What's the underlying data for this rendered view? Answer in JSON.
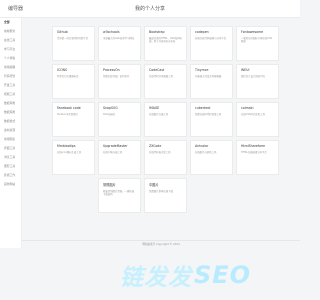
{
  "header": {
    "brand": "编导器",
    "title": "我的个人分享"
  },
  "sidebar": {
    "items": [
      {
        "label": "全部"
      },
      {
        "label": "前端框架"
      },
      {
        "label": "在线工具"
      },
      {
        "label": "学习平台"
      },
      {
        "label": "个人博客"
      },
      {
        "label": "常用编程"
      },
      {
        "label": "代码托管"
      },
      {
        "label": "开发工具"
      },
      {
        "label": "视频工具"
      },
      {
        "label": "数据库类"
      },
      {
        "label": "数据库类"
      },
      {
        "label": "数据格式"
      },
      {
        "label": "素材资源"
      },
      {
        "label": "常用图表"
      },
      {
        "label": "界面工具"
      },
      {
        "label": "浏览工具"
      },
      {
        "label": "图形工具"
      },
      {
        "label": "影视工作"
      },
      {
        "label": "其他网站"
      }
    ]
  },
  "cards": [
    {
      "name": "Github",
      "desc": "世界第一的开源代码托管平台"
    },
    {
      "name": "w3schools",
      "desc": "全球最大的web技术学习网站"
    },
    {
      "name": "Bootstrap",
      "desc": "最受欢迎的HTML、CSS和JS框架，用于开发响应式布局"
    },
    {
      "name": "codepen",
      "desc": "前端在线代码编辑与分享平台"
    },
    {
      "name": "Fontawesome",
      "desc": "一套绝佳的图标字体库和CSS框架"
    },
    {
      "name": "ICONS",
      "desc": "阿里巴巴矢量图标库"
    },
    {
      "name": "ProcessOn",
      "desc": "免费在线作图，实时协作"
    },
    {
      "name": "CodeCast",
      "desc": "在线代码分享截图工具"
    },
    {
      "name": "Tinymce",
      "desc": "功能强大的富文本编辑器"
    },
    {
      "name": "WEUI",
      "desc": "微信官方设计团队UI库"
    },
    {
      "name": "Facebook code",
      "desc": "Facebook开源项目"
    },
    {
      "name": "SnapSVG",
      "desc": "SVG动画库"
    },
    {
      "name": "IMAGE",
      "desc": "在线图片压缩工具"
    },
    {
      "name": "cubertext",
      "desc": "免费在线JS代码混淆工具"
    },
    {
      "name": "colmain",
      "desc": "在线CSS样式查询工具"
    },
    {
      "name": "Mmbiaotips",
      "desc": "在线icon图标生成工具"
    },
    {
      "name": "UpgradeMaster",
      "desc": "在线字体压缩工具"
    },
    {
      "name": "ZXCode",
      "desc": "在线代码格式化工具"
    },
    {
      "name": "Antcolor",
      "desc": "在线配色与颜色工具"
    },
    {
      "name": "HtmlShareform",
      "desc": "HTML在线编辑分享平台"
    },
    {
      "name": "常规图片",
      "desc": "收集常用图片资源，一键快速下载使用"
    },
    {
      "name": "中图片",
      "desc": "免费图片素材在线下载"
    }
  ],
  "footer": {
    "text": "网站备案号 Copyright © 2024"
  },
  "watermark": {
    "cn": "链发发",
    "en": "SEO"
  }
}
